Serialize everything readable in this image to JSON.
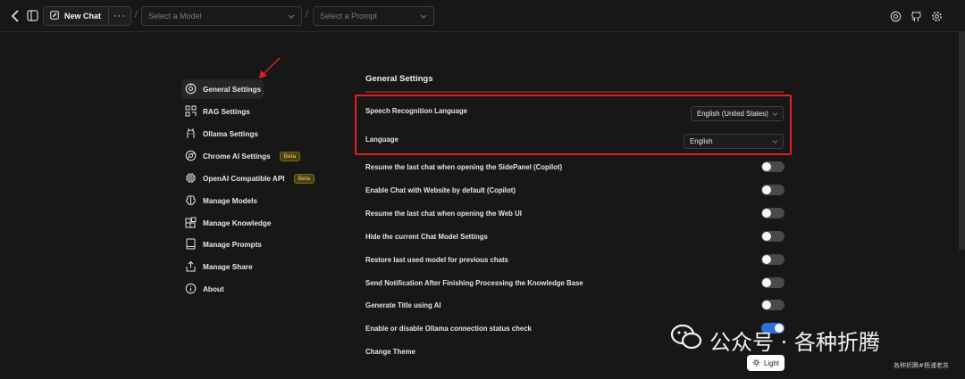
{
  "header": {
    "new_chat_label": "New Chat",
    "more_label": "···",
    "separator": "/",
    "model_select": {
      "placeholder": "Select a Model"
    },
    "prompt_select": {
      "placeholder": "Select a Prompt"
    },
    "icons": [
      "back-arrow-icon",
      "sidebar-toggle-icon",
      "edit-icon",
      "settings-cog-icon",
      "github-icon",
      "gear-icon"
    ]
  },
  "sidebar": {
    "items": [
      {
        "label": "General Settings",
        "icon": "general-settings-icon",
        "active": true
      },
      {
        "label": "RAG Settings",
        "icon": "rag-icon"
      },
      {
        "label": "Ollama Settings",
        "icon": "ollama-icon"
      },
      {
        "label": "Chrome AI Settings",
        "icon": "chrome-icon",
        "badge": "Beta"
      },
      {
        "label": "OpenAI Compatible API",
        "icon": "chip-icon",
        "badge": "Beta"
      },
      {
        "label": "Manage Models",
        "icon": "brain-icon"
      },
      {
        "label": "Manage Knowledge",
        "icon": "blocks-icon"
      },
      {
        "label": "Manage Prompts",
        "icon": "book-icon"
      },
      {
        "label": "Manage Share",
        "icon": "share-icon"
      },
      {
        "label": "About",
        "icon": "info-icon"
      }
    ]
  },
  "main": {
    "title": "General Settings",
    "speech_language": {
      "label": "Speech Recognition Language",
      "value": "English (United States)"
    },
    "language": {
      "label": "Language",
      "value": "English"
    },
    "toggles": [
      {
        "label": "Resume the last chat when opening the SidePanel (Copilot)",
        "on": false
      },
      {
        "label": "Enable Chat with Website by default (Copilot)",
        "on": false
      },
      {
        "label": "Resume the last chat when opening the Web UI",
        "on": false
      },
      {
        "label": "Hide the current Chat Model Settings",
        "on": false
      },
      {
        "label": "Restore last used model for previous chats",
        "on": false
      },
      {
        "label": "Send Notification After Finishing Processing the Knowledge Base",
        "on": false
      },
      {
        "label": "Generate Title using AI",
        "on": false
      },
      {
        "label": "Enable or disable Ollama connection status check",
        "on": true
      }
    ],
    "theme": {
      "label": "Change Theme",
      "button": "Light",
      "icon": "sun-icon"
    }
  },
  "watermark": {
    "main": "公众号 · 各种折腾",
    "sub": "各种折腾#杨浦老苏"
  },
  "colors": {
    "background": "#171717",
    "toggle_off": "#4a4a4a",
    "toggle_on": "#2f6fd8",
    "highlight": "#e0201e",
    "beta_text": "#f2d36b"
  }
}
